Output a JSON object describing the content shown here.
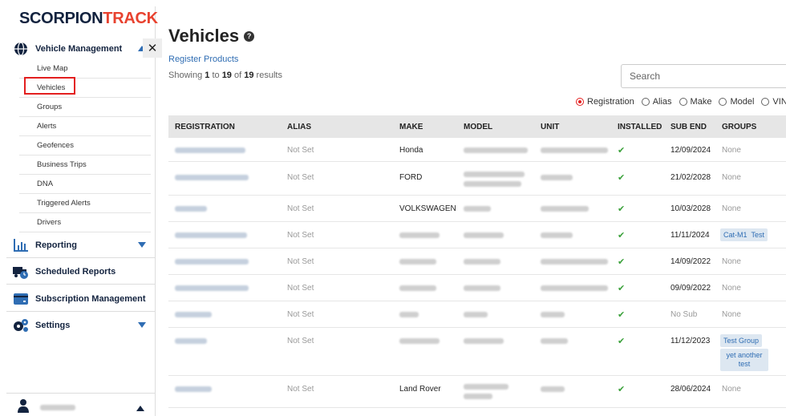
{
  "brand": {
    "name_part1": "SCORPION",
    "name_part2": "TRACK",
    "accent_color": "#e8422f",
    "primary_color": "#13233f"
  },
  "sidebar": {
    "vehicle_management": {
      "label": "Vehicle Management",
      "icon": "globe-icon",
      "items": [
        "Live Map",
        "Vehicles",
        "Groups",
        "Alerts",
        "Geofences",
        "Business Trips",
        "DNA",
        "Triggered Alerts",
        "Drivers"
      ],
      "selected": "Vehicles"
    },
    "reporting": {
      "label": "Reporting",
      "icon": "bar-chart-icon"
    },
    "scheduled_reports": {
      "label": "Scheduled Reports",
      "icon": "truck-clock-icon"
    },
    "subscription_management": {
      "label": "Subscription Management",
      "icon": "card-icon"
    },
    "settings": {
      "label": "Settings",
      "icon": "gears-icon"
    },
    "close_label": "✕"
  },
  "main": {
    "title": "Vehicles",
    "help_icon": "?",
    "register_link": "Register Products",
    "showing": {
      "prefix": "Showing ",
      "from": "1",
      "to_text": " to ",
      "to": "19",
      "of_text": " of ",
      "total": "19",
      "suffix": " results"
    },
    "search_placeholder": "Search",
    "filter_options": [
      "Registration",
      "Alias",
      "Make",
      "Model",
      "VIN"
    ],
    "filter_selected": "Registration",
    "columns": [
      "REGISTRATION",
      "ALIAS",
      "MAKE",
      "MODEL",
      "UNIT",
      "INSTALLED",
      "SUB END",
      "GROUPS"
    ],
    "rows": [
      {
        "alias": "Not Set",
        "make": "Honda",
        "installed": "✔",
        "sub_end": "12/09/2024",
        "groups": [
          "None"
        ]
      },
      {
        "alias": "Not Set",
        "make": "FORD",
        "installed": "✔",
        "sub_end": "21/02/2028",
        "groups": [
          "None"
        ]
      },
      {
        "alias": "Not Set",
        "make": "VOLKSWAGEN",
        "installed": "✔",
        "sub_end": "10/03/2028",
        "groups": [
          "None"
        ]
      },
      {
        "alias": "Not Set",
        "make": "",
        "installed": "✔",
        "sub_end": "11/11/2024",
        "groups": [
          "Cat-M1",
          "Test"
        ]
      },
      {
        "alias": "Not Set",
        "make": "",
        "installed": "✔",
        "sub_end": "14/09/2022",
        "groups": [
          "None"
        ]
      },
      {
        "alias": "Not Set",
        "make": "",
        "installed": "✔",
        "sub_end": "09/09/2022",
        "groups": [
          "None"
        ]
      },
      {
        "alias": "Not Set",
        "make": "",
        "installed": "✔",
        "sub_end": "No Sub",
        "groups": [
          "None"
        ]
      },
      {
        "alias": "Not Set",
        "make": "",
        "installed": "✔",
        "sub_end": "11/12/2023",
        "groups": [
          "Test Group",
          "yet another test"
        ]
      },
      {
        "alias": "Not Set",
        "make": "Land Rover",
        "installed": "✔",
        "sub_end": "28/06/2024",
        "groups": [
          "None"
        ]
      }
    ]
  }
}
